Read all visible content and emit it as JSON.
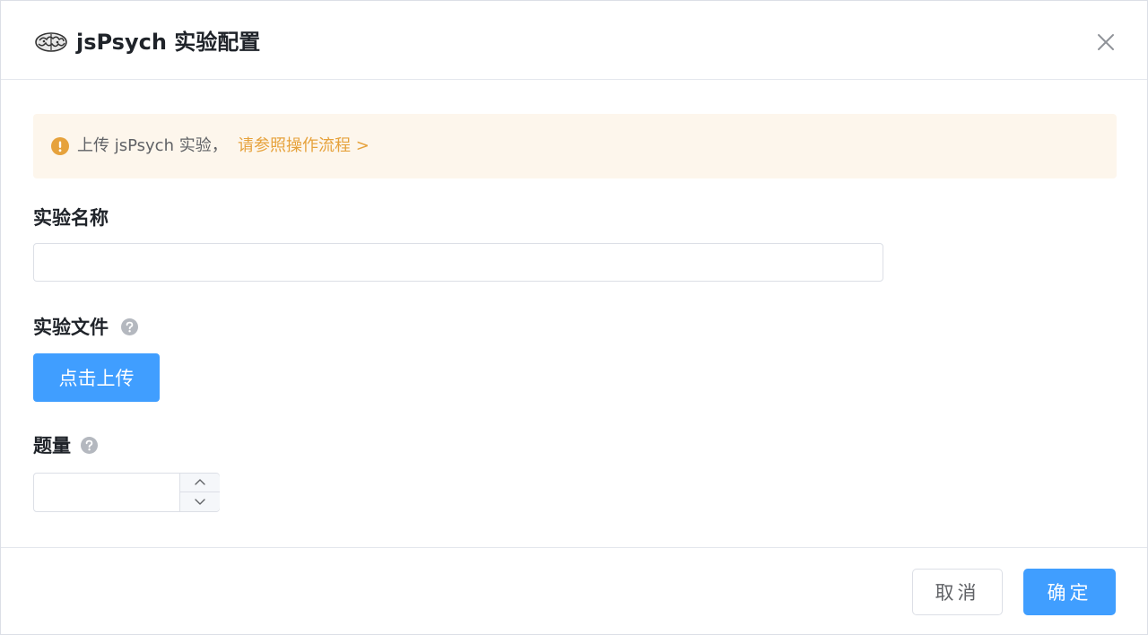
{
  "dialog": {
    "title": "jsPsych 实验配置",
    "brand_icon": "brain-icon",
    "close_icon": "close-icon"
  },
  "alert": {
    "icon": "warning-circle-icon",
    "text": "上传 jsPsych 实验，",
    "link_text": "请参照操作流程 >",
    "colors": {
      "background": "#fdf6ec",
      "icon": "#e6a23c",
      "link": "#e6a23c"
    }
  },
  "form": {
    "name": {
      "label": "实验名称",
      "value": "",
      "placeholder": ""
    },
    "file": {
      "label": "实验文件",
      "help_icon": "question-circle-icon",
      "upload_label": "点击上传"
    },
    "count": {
      "label": "题量",
      "help_icon": "question-circle-icon",
      "value": "",
      "increase_icon": "chevron-up-icon",
      "decrease_icon": "chevron-down-icon"
    }
  },
  "footer": {
    "cancel_label": "取消",
    "confirm_label": "确定"
  },
  "colors": {
    "primary": "#409eff",
    "border": "#dcdfe6"
  }
}
